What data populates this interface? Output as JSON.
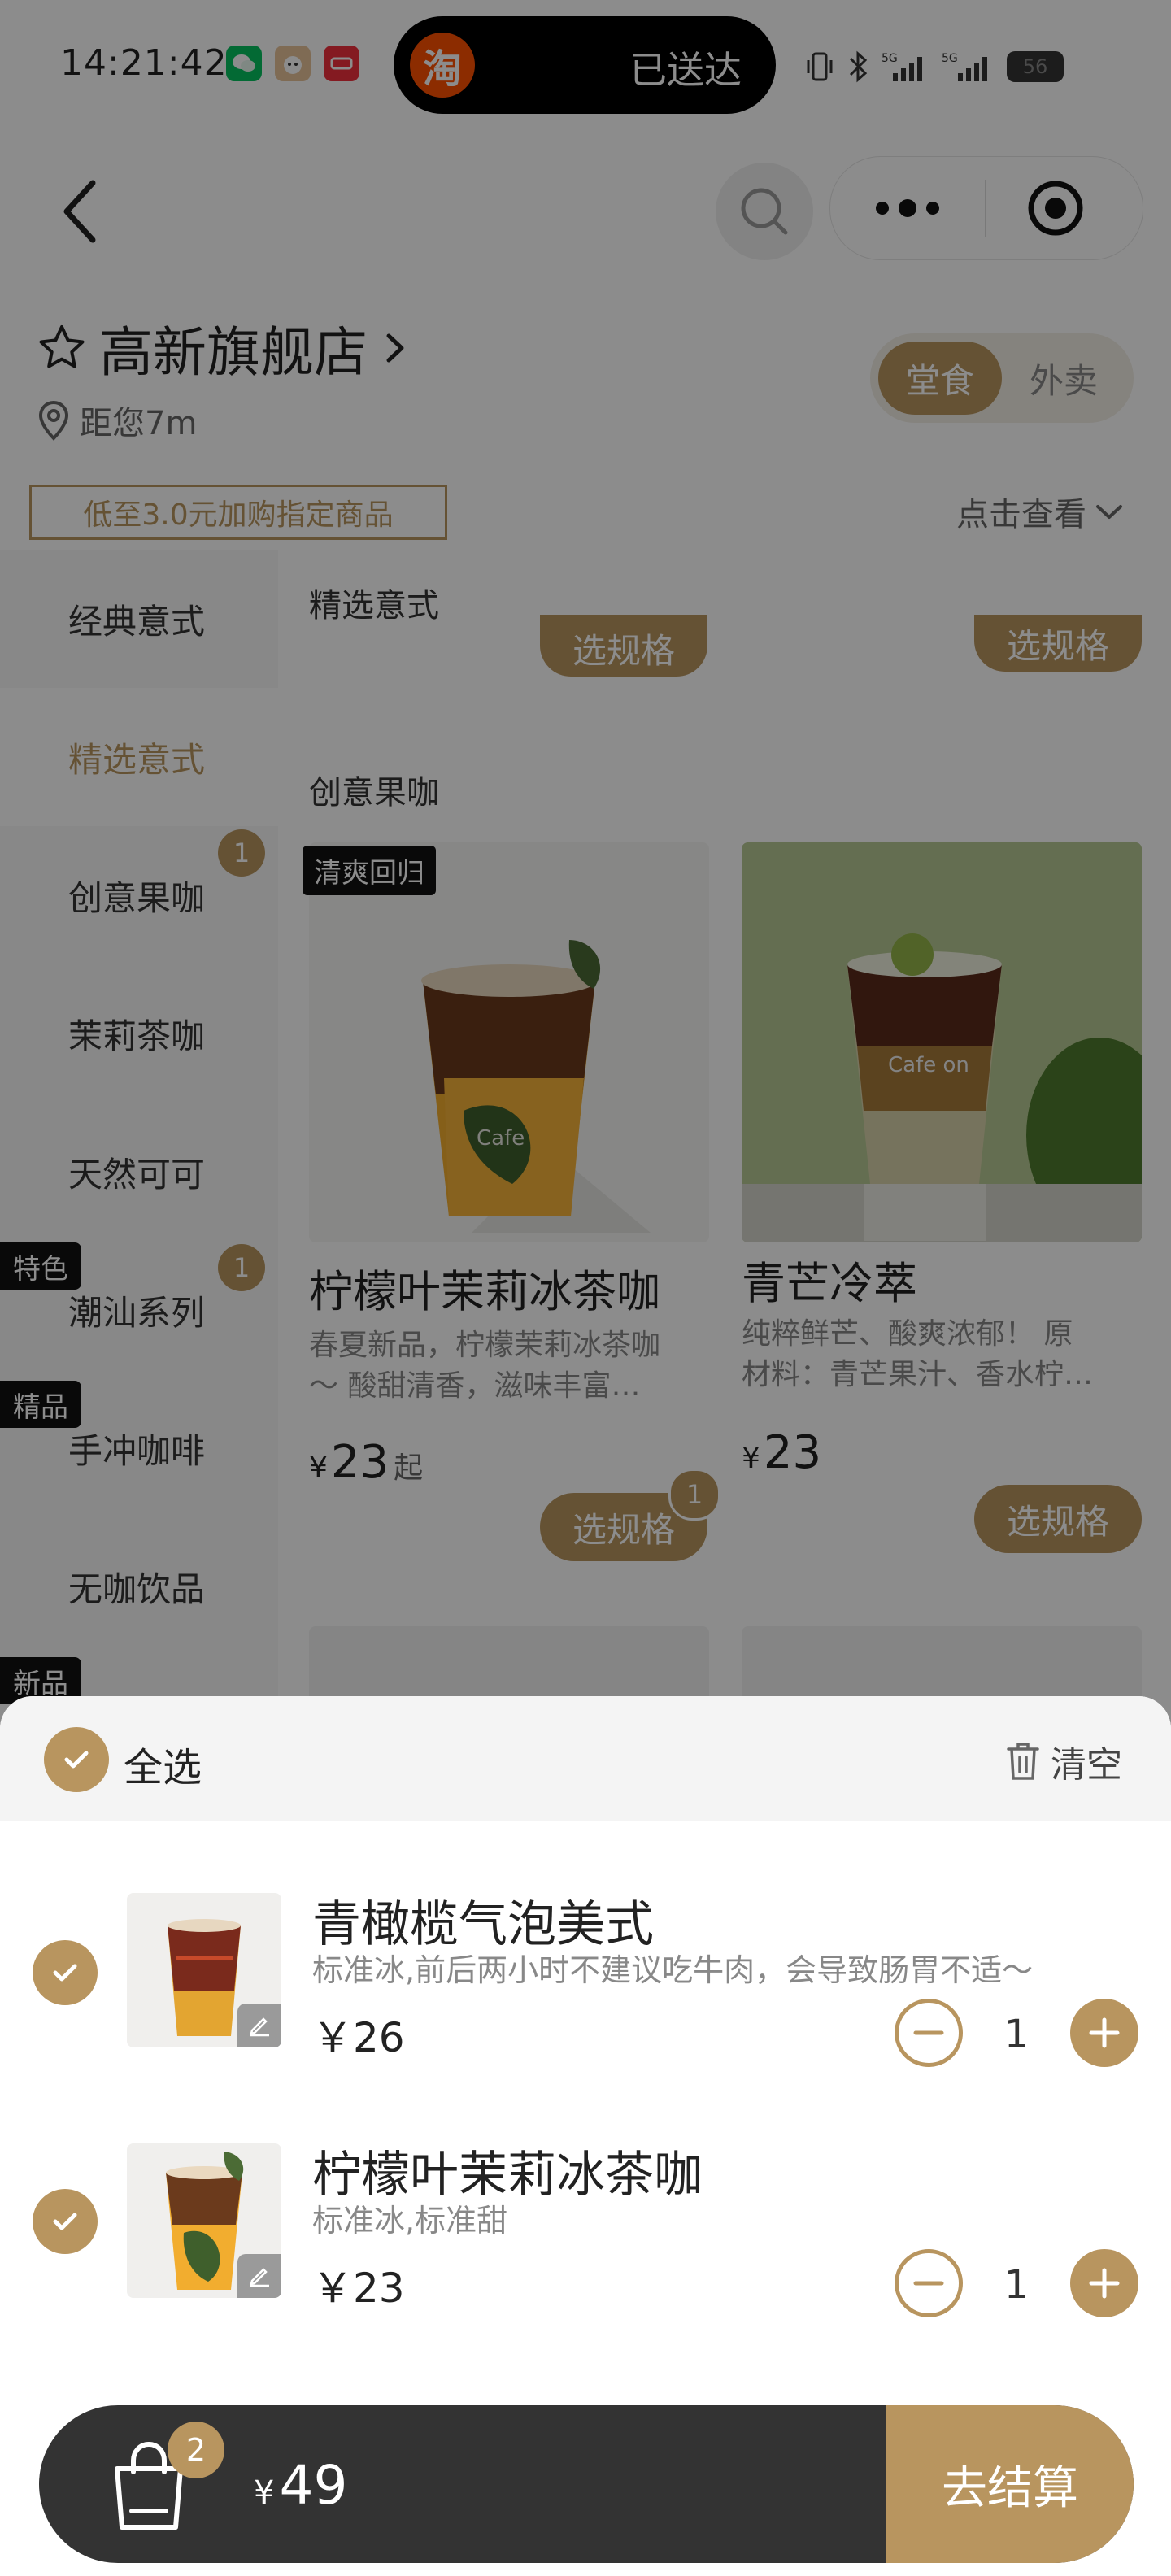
{
  "status_bar": {
    "time": "14:21:42",
    "island_text": "已送达",
    "taobao_glyph": "淘",
    "battery": "56",
    "icons": [
      "wechat-icon",
      "cat-app-icon",
      "app-red-icon",
      "vibrate-icon",
      "bluetooth-icon",
      "signal-5g-icon",
      "signal-5g-icon-2"
    ]
  },
  "header": {
    "store_name": "高新旗舰店",
    "distance": "距您7m",
    "modes": [
      "堂食",
      "外卖"
    ],
    "active_mode": "堂食",
    "promo": "低至3.0元加购指定商品",
    "view_more": "点击查看"
  },
  "sidebar": {
    "items": [
      {
        "label": "经典意式",
        "badge": "",
        "tag": ""
      },
      {
        "label": "精选意式",
        "badge": "",
        "tag": ""
      },
      {
        "label": "创意果咖",
        "badge": "1",
        "tag": ""
      },
      {
        "label": "茉莉茶咖",
        "badge": "",
        "tag": ""
      },
      {
        "label": "天然可可",
        "badge": "",
        "tag": ""
      },
      {
        "label": "潮汕系列",
        "badge": "1",
        "tag": "特色"
      },
      {
        "label": "手冲咖啡",
        "badge": "",
        "tag": "精品"
      },
      {
        "label": "无咖饮品",
        "badge": "",
        "tag": ""
      }
    ],
    "extra_tag": "新品"
  },
  "main": {
    "sticky_title": "精选意式",
    "spec_label": "选规格",
    "section_title": "创意果咖",
    "products": [
      {
        "name": "柠檬叶茉莉冰茶咖",
        "desc_line1": "春夏新品，柠檬茉莉冰茶咖",
        "desc_line2": "～ 酸甜清香，滋味丰富…",
        "price": "23",
        "yen": "¥",
        "suffix": "起",
        "tag": "清爽回归",
        "qty": "1"
      },
      {
        "name": "青芒冷萃",
        "desc_line1": "纯粹鲜芒、酸爽浓郁！ 原",
        "desc_line2": "材料：青芒果汁、香水柠…",
        "price": "23",
        "yen": "¥",
        "suffix": "",
        "tag": "",
        "qty": ""
      }
    ]
  },
  "cart": {
    "select_all": "全选",
    "clear": "清空",
    "items": [
      {
        "name": "青橄榄气泡美式",
        "spec": "标准冰,前后两小时不建议吃牛肉，会导致肠胃不适～",
        "price": "￥26",
        "qty": "1"
      },
      {
        "name": "柠檬叶茉莉冰茶咖",
        "spec": "标准冰,标准甜",
        "price": "￥23",
        "qty": "1"
      }
    ]
  },
  "checkout": {
    "count": "2",
    "yen": "¥",
    "total": "49",
    "button": "去结算"
  },
  "colors": {
    "accent": "#b8955f",
    "bar": "#333333",
    "overlay": "rgba(0,0,0,0.45)"
  }
}
